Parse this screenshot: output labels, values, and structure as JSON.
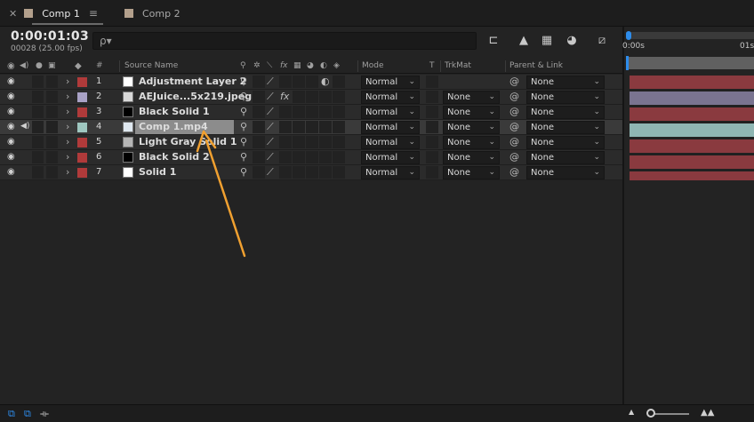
{
  "tabs": [
    {
      "label": "Comp 1",
      "active": true
    },
    {
      "label": "Comp 2",
      "active": false
    }
  ],
  "controls": {
    "timecode": "0:00:01:03",
    "fps": "00028 (25.00 fps)",
    "search_placeholder": "",
    "search_icon": "ρ▾"
  },
  "columns": {
    "source_name": "Source Name",
    "number": "#",
    "mode": "Mode",
    "t": "T",
    "trkmat": "TrkMat",
    "parent": "Parent & Link",
    "switch_fx": "fx"
  },
  "layers": [
    {
      "num": "1",
      "name": "Adjustment Layer 2",
      "label_color": "#b03a3a",
      "thumb_color": "#ffffff",
      "mode": "Normal",
      "trkmat": "",
      "parent": "None",
      "fx": false,
      "audio": false,
      "selected": false,
      "bar_color": "#8a3a3f"
    },
    {
      "num": "2",
      "name": "AEJuice...5x219.jpeg",
      "label_color": "#a9a2c6",
      "thumb_color": "#d9d9d9",
      "mode": "Normal",
      "trkmat": "None",
      "parent": "None",
      "fx": true,
      "audio": false,
      "selected": false,
      "bar_color": "#7a7490"
    },
    {
      "num": "3",
      "name": "Black Solid 1",
      "label_color": "#b03a3a",
      "thumb_color": "#000000",
      "mode": "Normal",
      "trkmat": "None",
      "parent": "None",
      "fx": false,
      "audio": false,
      "selected": false,
      "bar_color": "#8a3a3f"
    },
    {
      "num": "4",
      "name": "Comp 1.mp4",
      "label_color": "#9fc7c0",
      "thumb_color": "#dfe8f0",
      "mode": "Normal",
      "trkmat": "None",
      "parent": "None",
      "fx": false,
      "audio": true,
      "selected": true,
      "bar_color": "#8fb6b3"
    },
    {
      "num": "5",
      "name": "Light Gray Solid 1",
      "label_color": "#b03a3a",
      "thumb_color": "#b5b5b5",
      "mode": "Normal",
      "trkmat": "None",
      "parent": "None",
      "fx": false,
      "audio": false,
      "selected": false,
      "bar_color": "#8a3a3f"
    },
    {
      "num": "6",
      "name": "Black Solid 2",
      "label_color": "#b03a3a",
      "thumb_color": "#000000",
      "mode": "Normal",
      "trkmat": "None",
      "parent": "None",
      "fx": false,
      "audio": false,
      "selected": false,
      "bar_color": "#8a3a3f"
    },
    {
      "num": "7",
      "name": "Solid 1",
      "label_color": "#b03a3a",
      "thumb_color": "#ffffff",
      "mode": "Normal",
      "trkmat": "None",
      "parent": "None",
      "fx": false,
      "audio": false,
      "selected": false,
      "bar_color": "#8a3a3f"
    }
  ],
  "timeline": {
    "tick_start": "0:00s",
    "tick_next": "01s"
  },
  "colors": {
    "accent_blue": "#2d8ceb",
    "annotation_arrow": "#f0a030"
  }
}
